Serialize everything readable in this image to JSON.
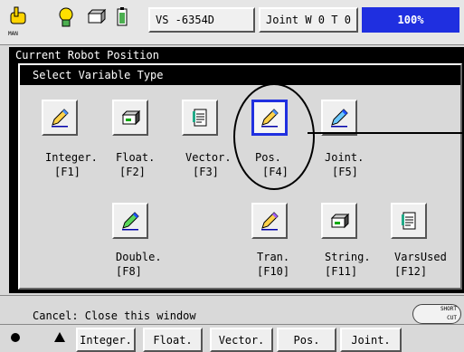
{
  "toolbar": {
    "mode_caption": "MAN",
    "robot_id": "VS -6354D",
    "coord_system": "Joint  W 0 T 0",
    "speed": "100%",
    "icons": [
      "hand-icon",
      "lightbulb-icon",
      "robot-base-icon",
      "battery-icon"
    ]
  },
  "background_title": "Current Robot Position",
  "dialog": {
    "title": "Select Variable Type",
    "row1": [
      {
        "name": "Integer.",
        "key": "[F1]",
        "icon": "pencil-icon"
      },
      {
        "name": "Float.",
        "key": "[F2]",
        "icon": "box-icon"
      },
      {
        "name": "Vector.",
        "key": "[F3]",
        "icon": "document-icon"
      },
      {
        "name": "Pos.",
        "key": "[F4]",
        "icon": "pencil-icon",
        "selected": true
      },
      {
        "name": "Joint.",
        "key": "[F5]",
        "icon": "pencil-icon"
      }
    ],
    "row2": [
      {
        "name": "Double.",
        "key": "[F8]",
        "icon": "pencil-green-icon"
      },
      {
        "name": "Tran.",
        "key": "[F10]",
        "icon": "pencil-icon"
      },
      {
        "name": "String.",
        "key": "[F11]",
        "icon": "box-icon"
      },
      {
        "name": "VarsUsed",
        "key": "[F12]",
        "icon": "document-icon"
      }
    ]
  },
  "status": "Cancel: Close this window",
  "shortcut": {
    "line1": "SHORT",
    "line2": "CUT"
  },
  "fkeys": [
    "Integer.",
    "Float.",
    "Vector.",
    "Pos.",
    "Joint."
  ]
}
